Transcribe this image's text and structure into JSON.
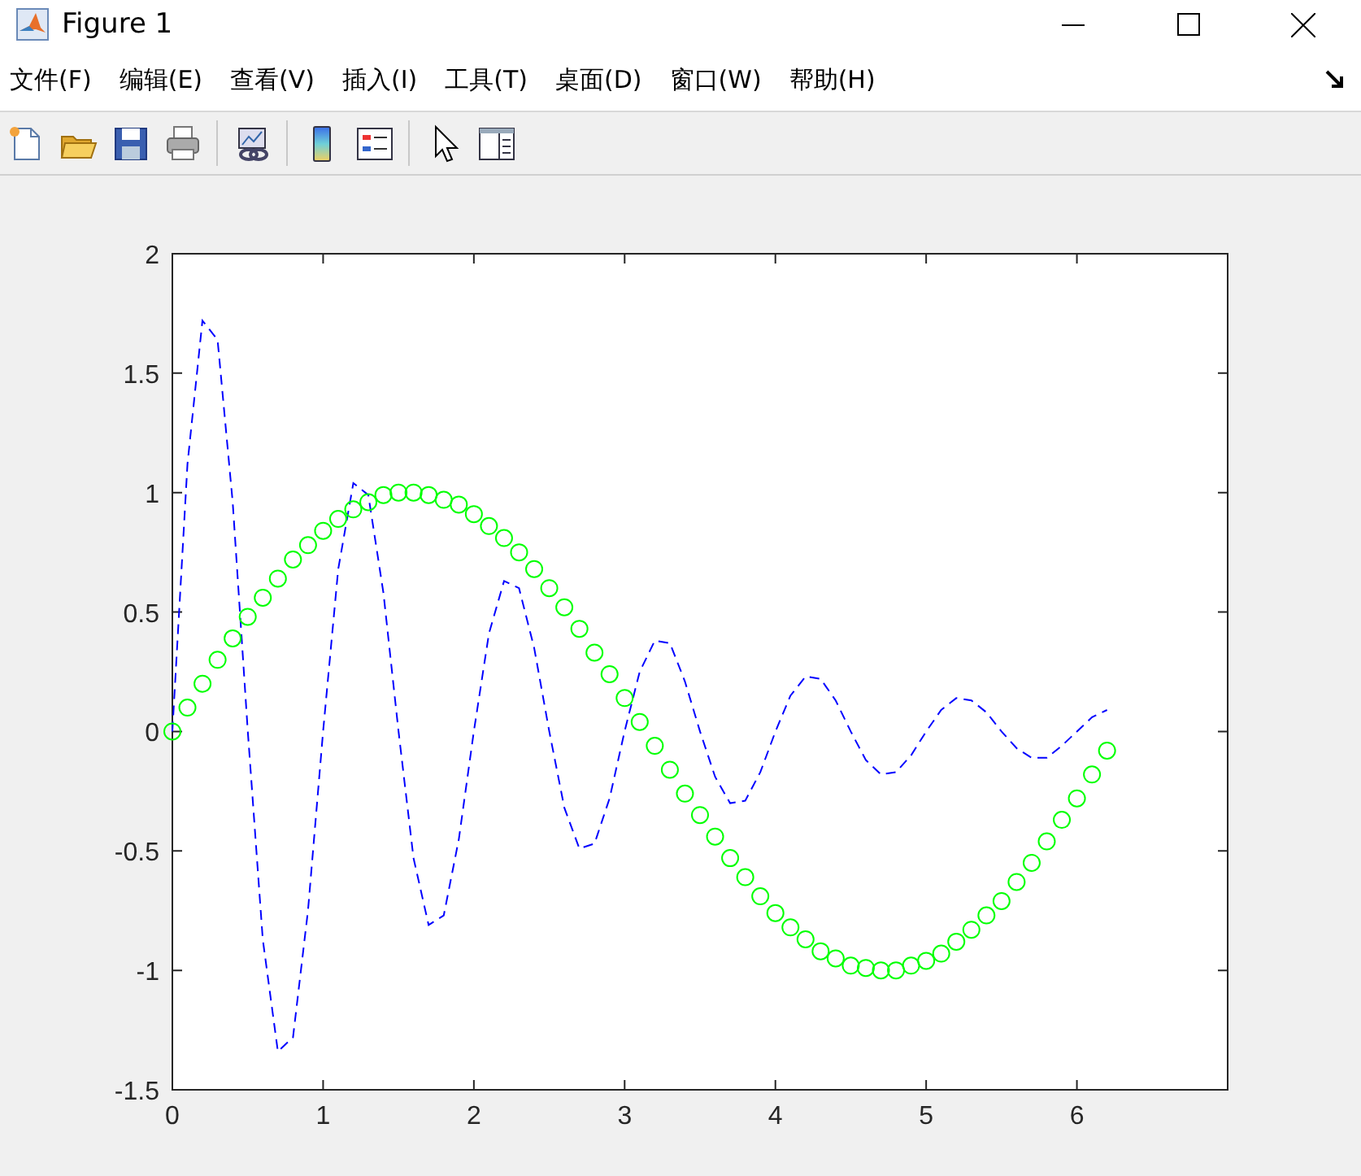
{
  "window": {
    "title": "Figure 1"
  },
  "menu": [
    {
      "label": "文件(F)"
    },
    {
      "label": "编辑(E)"
    },
    {
      "label": "查看(V)"
    },
    {
      "label": "插入(I)"
    },
    {
      "label": "工具(T)"
    },
    {
      "label": "桌面(D)"
    },
    {
      "label": "窗口(W)"
    },
    {
      "label": "帮助(H)"
    }
  ],
  "toolbar": [
    {
      "kind": "new"
    },
    {
      "kind": "open"
    },
    {
      "kind": "save"
    },
    {
      "kind": "print"
    },
    {
      "kind": "separator"
    },
    {
      "kind": "link"
    },
    {
      "kind": "separator"
    },
    {
      "kind": "colorbar"
    },
    {
      "kind": "legend"
    },
    {
      "kind": "separator"
    },
    {
      "kind": "pointer"
    },
    {
      "kind": "inspector"
    }
  ],
  "axes": {
    "chart_data": {
      "type": "line",
      "x": [
        0,
        0.1,
        0.2,
        0.3,
        0.4,
        0.5,
        0.6,
        0.7,
        0.8,
        0.9,
        1,
        1.1,
        1.2,
        1.3,
        1.4,
        1.5,
        1.6,
        1.7,
        1.8,
        1.9,
        2,
        2.1,
        2.2,
        2.3,
        2.4,
        2.5,
        2.6,
        2.7,
        2.8,
        2.9,
        3,
        3.1,
        3.2,
        3.3,
        3.4,
        3.5,
        3.6,
        3.7,
        3.8,
        3.9,
        4,
        4.1,
        4.2,
        4.3,
        4.4,
        4.5,
        4.6,
        4.7,
        4.8,
        4.9,
        5,
        5.1,
        5.2,
        5.3,
        5.4,
        5.5,
        5.6,
        5.7,
        5.8,
        5.9,
        6,
        6.1,
        6.2
      ],
      "series": [
        {
          "color": "#0000ff",
          "line_style": "dashed",
          "marker": "none",
          "values": [
            0,
            1.12,
            1.72,
            1.64,
            0.96,
            0,
            -0.87,
            -1.34,
            -1.28,
            -0.75,
            0,
            0.68,
            1.04,
            0.99,
            0.58,
            0,
            -0.53,
            -0.81,
            -0.77,
            -0.45,
            0,
            0.41,
            0.63,
            0.6,
            0.35,
            0,
            -0.32,
            -0.49,
            -0.47,
            -0.28,
            0,
            0.25,
            0.38,
            0.37,
            0.21,
            0,
            -0.19,
            -0.3,
            -0.29,
            -0.17,
            0,
            0.15,
            0.23,
            0.22,
            0.13,
            0,
            -0.12,
            -0.18,
            -0.17,
            -0.1,
            0,
            0.09,
            0.14,
            0.13,
            0.08,
            0,
            -0.07,
            -0.11,
            -0.11,
            -0.06,
            0,
            0.06,
            0.09
          ]
        },
        {
          "type": "scatter",
          "color": "#00ff00",
          "marker": "circle",
          "values": [
            0,
            0.1,
            0.2,
            0.3,
            0.39,
            0.48,
            0.56,
            0.64,
            0.72,
            0.78,
            0.84,
            0.89,
            0.93,
            0.96,
            0.99,
            1,
            1,
            0.99,
            0.97,
            0.95,
            0.91,
            0.86,
            0.81,
            0.75,
            0.68,
            0.6,
            0.52,
            0.43,
            0.33,
            0.24,
            0.14,
            0.04,
            -0.06,
            -0.16,
            -0.26,
            -0.35,
            -0.44,
            -0.53,
            -0.61,
            -0.69,
            -0.76,
            -0.82,
            -0.87,
            -0.92,
            -0.95,
            -0.98,
            -0.99,
            -1,
            -1,
            -0.98,
            -0.96,
            -0.93,
            -0.88,
            -0.83,
            -0.77,
            -0.71,
            -0.63,
            -0.55,
            -0.46,
            -0.37,
            -0.28,
            -0.18,
            -0.08
          ]
        }
      ],
      "xlim": [
        0,
        7
      ],
      "ylim": [
        -1.5,
        2
      ],
      "xticks": [
        0,
        1,
        2,
        3,
        4,
        5,
        6
      ],
      "yticks": [
        -1.5,
        -1,
        -0.5,
        0,
        0.5,
        1,
        1.5,
        2
      ]
    }
  }
}
